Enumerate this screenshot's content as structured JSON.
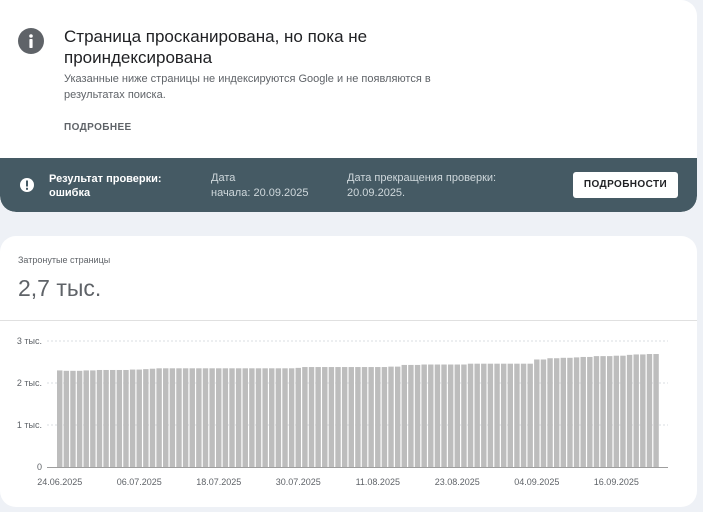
{
  "issue": {
    "title": "Страница просканирована, но пока не проиндексирована",
    "description": "Указанные ниже страницы не индексируются Google и не появляются в результатах поиска.",
    "learn_more": "ПОДРОБНЕЕ"
  },
  "validation": {
    "result_label": "Результат проверки: ошибка",
    "start_label": "Дата",
    "start_value": "начала: 20.09.2025",
    "end_label": "Дата прекращения проверки:",
    "end_value": "20.09.2025.",
    "details_button": "ПОДРОБНОСТИ",
    "colors": {
      "bar": "#455a64"
    }
  },
  "metric": {
    "label": "Затронутые страницы",
    "value": "2,7 тыс."
  },
  "chart_data": {
    "type": "bar",
    "ylim": [
      0,
      3000
    ],
    "yticks": [
      {
        "value": 0,
        "label": "0"
      },
      {
        "value": 1000,
        "label": "1 тыс."
      },
      {
        "value": 2000,
        "label": "2 тыс."
      },
      {
        "value": 3000,
        "label": "3 тыс."
      }
    ],
    "xticks": [
      {
        "index": 0,
        "label": "24.06.2025"
      },
      {
        "index": 12,
        "label": "06.07.2025"
      },
      {
        "index": 24,
        "label": "18.07.2025"
      },
      {
        "index": 36,
        "label": "30.07.2025"
      },
      {
        "index": 48,
        "label": "11.08.2025"
      },
      {
        "index": 60,
        "label": "23.08.2025"
      },
      {
        "index": 72,
        "label": "04.09.2025"
      },
      {
        "index": 84,
        "label": "16.09.2025"
      }
    ],
    "categories": [
      "24.06",
      "25.06",
      "26.06",
      "27.06",
      "28.06",
      "29.06",
      "30.06",
      "01.07",
      "02.07",
      "03.07",
      "04.07",
      "05.07",
      "06.07",
      "07.07",
      "08.07",
      "09.07",
      "10.07",
      "11.07",
      "12.07",
      "13.07",
      "14.07",
      "15.07",
      "16.07",
      "17.07",
      "18.07",
      "19.07",
      "20.07",
      "21.07",
      "22.07",
      "23.07",
      "24.07",
      "25.07",
      "26.07",
      "27.07",
      "28.07",
      "29.07",
      "30.07",
      "31.07",
      "01.08",
      "02.08",
      "03.08",
      "04.08",
      "05.08",
      "06.08",
      "07.08",
      "08.08",
      "09.08",
      "10.08",
      "11.08",
      "12.08",
      "13.08",
      "14.08",
      "15.08",
      "16.08",
      "17.08",
      "18.08",
      "19.08",
      "20.08",
      "21.08",
      "22.08",
      "23.08",
      "24.08",
      "25.08",
      "26.08",
      "27.08",
      "28.08",
      "29.08",
      "30.08",
      "31.08",
      "01.09",
      "02.09",
      "03.09",
      "04.09",
      "05.09",
      "06.09",
      "07.09",
      "08.09",
      "09.09",
      "10.09",
      "11.09",
      "12.09",
      "13.09",
      "14.09",
      "15.09",
      "16.09",
      "17.09",
      "18.09",
      "19.09",
      "20.09"
    ],
    "values": [
      2300,
      2290,
      2290,
      2290,
      2300,
      2300,
      2310,
      2310,
      2310,
      2310,
      2310,
      2320,
      2320,
      2330,
      2340,
      2350,
      2350,
      2350,
      2350,
      2350,
      2350,
      2350,
      2350,
      2350,
      2350,
      2350,
      2350,
      2350,
      2350,
      2350,
      2350,
      2350,
      2350,
      2350,
      2350,
      2350,
      2360,
      2380,
      2380,
      2380,
      2380,
      2380,
      2380,
      2380,
      2380,
      2380,
      2380,
      2380,
      2380,
      2380,
      2390,
      2390,
      2430,
      2430,
      2430,
      2440,
      2440,
      2440,
      2440,
      2440,
      2440,
      2440,
      2460,
      2460,
      2460,
      2460,
      2460,
      2460,
      2460,
      2460,
      2460,
      2460,
      2560,
      2560,
      2590,
      2590,
      2600,
      2600,
      2610,
      2620,
      2620,
      2640,
      2640,
      2640,
      2650,
      2650,
      2670,
      2680,
      2680,
      2690,
      2690
    ]
  }
}
